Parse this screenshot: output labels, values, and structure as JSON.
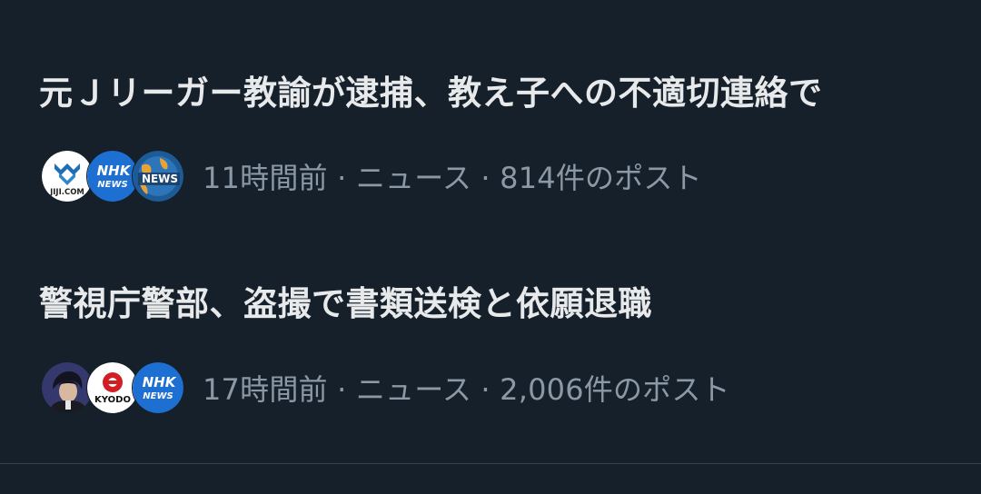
{
  "news": [
    {
      "headline": "元Ｊリーガー教諭が逮捕、教え子への不適切連絡で",
      "meta": "11時間前 · ニュース · 814件のポスト",
      "avatars": [
        {
          "icon": "jiji-com-logo",
          "text": "JIJI.COM"
        },
        {
          "icon": "nhk-news-logo",
          "text": "NHK NEWS"
        },
        {
          "icon": "news-globe-logo",
          "text": "NEWS"
        }
      ]
    },
    {
      "headline": "警視庁警部、盗撮で書類送検と依願退職",
      "meta": "17時間前 · ニュース · 2,006件のポスト",
      "avatars": [
        {
          "icon": "user-portrait-avatar",
          "text": ""
        },
        {
          "icon": "kyodo-logo",
          "text": "KYODO"
        },
        {
          "icon": "nhk-news-logo",
          "text": "NHK NEWS"
        }
      ]
    }
  ],
  "colors": {
    "background": "#15202b",
    "headline": "#e7e9ea",
    "meta": "#8b98a5",
    "divider": "#38444d",
    "nhk_blue": "#1d6fd1",
    "jiji_blue": "#1f6db5",
    "kyodo_red": "#d21f26"
  }
}
